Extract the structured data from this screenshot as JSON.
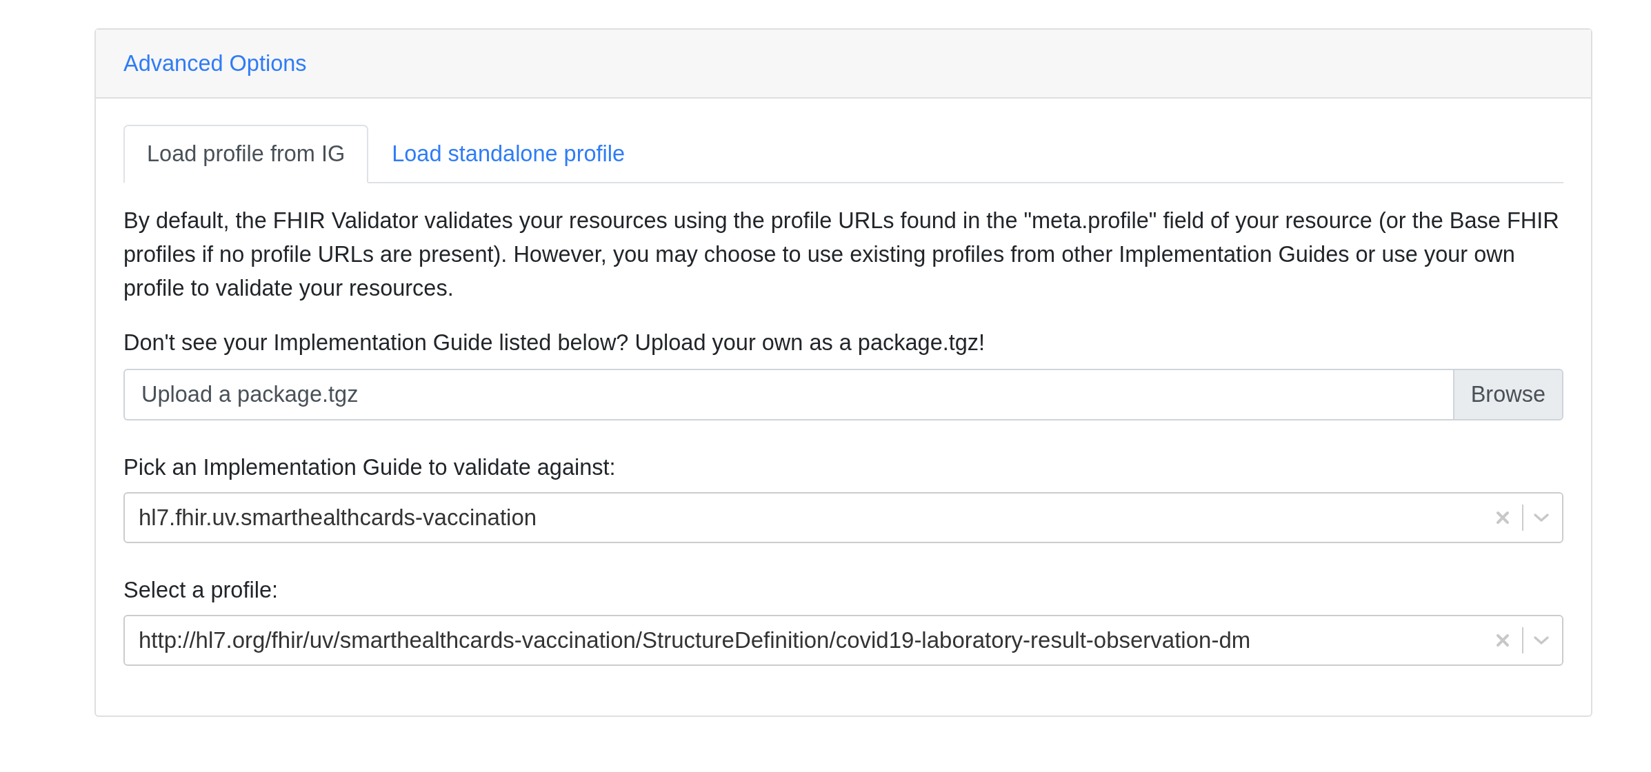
{
  "card": {
    "header": "Advanced Options"
  },
  "tabs": [
    {
      "label": "Load profile from IG",
      "selected": true
    },
    {
      "label": "Load standalone profile",
      "selected": false
    }
  ],
  "description": "By default, the FHIR Validator validates your resources using the profile URLs found in the \"meta.profile\" field of your resource (or the Base FHIR profiles if no profile URLs are present). However, you may choose to use existing profiles from other Implementation Guides or use your own profile to validate your resources.",
  "upload": {
    "label": "Don't see your Implementation Guide listed below? Upload your own as a package.tgz!",
    "placeholder": "Upload a package.tgz",
    "button": "Browse"
  },
  "selects": [
    {
      "label": "Pick an Implementation Guide to validate against:",
      "value": "hl7.fhir.uv.smarthealthcards-vaccination"
    },
    {
      "label": "Select a profile:",
      "value": "http://hl7.org/fhir/uv/smarthealthcards-vaccination/StructureDefinition/covid19-laboratory-result-observation-dm"
    }
  ]
}
